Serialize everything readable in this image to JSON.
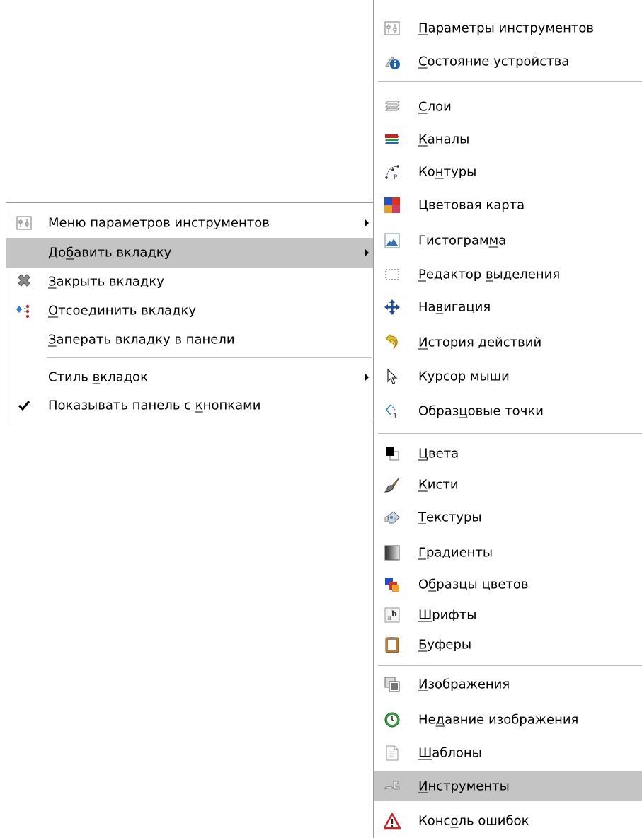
{
  "main_menu": {
    "items": [
      {
        "name": "menu-item-tool-options-menu",
        "pre": "Меню параметров инструментов",
        "u": "",
        "post": "",
        "icon": "tool-options-icon",
        "submenu": true,
        "checked": false,
        "highlighted": false
      },
      {
        "name": "menu-item-add-tab",
        "pre": "До",
        "u": "б",
        "post": "авить вкладку",
        "icon": "",
        "submenu": true,
        "checked": false,
        "highlighted": true
      },
      {
        "name": "menu-item-close-tab",
        "pre": "",
        "u": "З",
        "post": "акрыть вкладку",
        "icon": "close-tab-icon",
        "submenu": false,
        "checked": false,
        "highlighted": false
      },
      {
        "name": "menu-item-detach-tab",
        "pre": "",
        "u": "О",
        "post": "тсоединить вкладку",
        "icon": "detach-tab-icon",
        "submenu": false,
        "checked": false,
        "highlighted": false
      },
      {
        "name": "menu-item-lock-tab",
        "pre": "",
        "u": "З",
        "post": "аперать вкладку в панели",
        "icon": "",
        "submenu": false,
        "checked": false,
        "highlighted": false
      },
      {
        "name": "menu-item-tab-style",
        "pre": "Стиль ",
        "u": "в",
        "post": "кладок",
        "icon": "",
        "submenu": true,
        "checked": false,
        "highlighted": false
      },
      {
        "name": "menu-item-show-button-bar",
        "pre": "Показывать панель с ",
        "u": "к",
        "post": "нопками",
        "icon": "checkmark-icon",
        "submenu": false,
        "checked": true,
        "highlighted": false
      }
    ]
  },
  "sub_menu": {
    "items": [
      {
        "name": "submenu-item-tool-options",
        "pre": "",
        "u": "П",
        "post": "араметры инструментов",
        "icon": "tool-options-icon",
        "highlighted": false
      },
      {
        "name": "submenu-item-device-status",
        "pre": "",
        "u": "С",
        "post": "остояние устройства",
        "icon": "device-status-icon",
        "highlighted": false
      },
      {
        "name": "submenu-item-layers",
        "pre": "",
        "u": "С",
        "post": "лои",
        "icon": "layers-icon",
        "highlighted": false
      },
      {
        "name": "submenu-item-channels",
        "pre": "",
        "u": "К",
        "post": "аналы",
        "icon": "channels-icon",
        "highlighted": false
      },
      {
        "name": "submenu-item-paths",
        "pre": "Ко",
        "u": "н",
        "post": "туры",
        "icon": "paths-icon",
        "highlighted": false
      },
      {
        "name": "submenu-item-colormap",
        "pre": "Цветовая карта",
        "u": "",
        "post": "",
        "icon": "colormap-icon",
        "highlighted": false
      },
      {
        "name": "submenu-item-histogram",
        "pre": "Гистограм",
        "u": "м",
        "post": "а",
        "icon": "histogram-icon",
        "highlighted": false
      },
      {
        "name": "submenu-item-selection-editor",
        "pre": "",
        "u": "Р",
        "post": "едактор ",
        "u2": "в",
        "post2": "ыделения",
        "icon": "selection-editor-icon",
        "highlighted": false
      },
      {
        "name": "submenu-item-navigation",
        "pre": "На",
        "u": "в",
        "post": "игация",
        "icon": "navigation-icon",
        "highlighted": false
      },
      {
        "name": "submenu-item-undo-history",
        "pre": "",
        "u": "И",
        "post": "стория действий",
        "icon": "undo-history-icon",
        "highlighted": false
      },
      {
        "name": "submenu-item-pointer",
        "pre": "Курсор мыши",
        "u": "",
        "post": "",
        "icon": "pointer-icon",
        "highlighted": false
      },
      {
        "name": "submenu-item-sample-points",
        "pre": "Образ",
        "u": "ц",
        "post": "овые точки",
        "icon": "sample-points-icon",
        "highlighted": false
      },
      {
        "name": "submenu-item-colors",
        "pre": "",
        "u": "Ц",
        "post": "вета",
        "icon": "colors-icon",
        "highlighted": false
      },
      {
        "name": "submenu-item-brushes",
        "pre": "",
        "u": "К",
        "post": "исти",
        "icon": "brushes-icon",
        "highlighted": false
      },
      {
        "name": "submenu-item-patterns",
        "pre": "",
        "u": "Т",
        "post": "екстуры",
        "icon": "patterns-icon",
        "highlighted": false
      },
      {
        "name": "submenu-item-gradients",
        "pre": "",
        "u": "Г",
        "post": "радиенты",
        "icon": "gradients-icon",
        "highlighted": false
      },
      {
        "name": "submenu-item-palettes",
        "pre": "О",
        "u": "б",
        "post": "разцы цветов",
        "icon": "palettes-icon",
        "highlighted": false
      },
      {
        "name": "submenu-item-fonts",
        "pre": "",
        "u": "Ш",
        "post": "рифты",
        "icon": "fonts-icon",
        "highlighted": false
      },
      {
        "name": "submenu-item-buffers",
        "pre": "",
        "u": "Б",
        "post": "уферы",
        "icon": "buffers-icon",
        "highlighted": false
      },
      {
        "name": "submenu-item-images",
        "pre": "",
        "u": "И",
        "post": "зображения",
        "icon": "images-icon",
        "highlighted": false
      },
      {
        "name": "submenu-item-document-history",
        "pre": "Не",
        "u": "д",
        "post": "авние изображения",
        "icon": "document-history-icon",
        "highlighted": false
      },
      {
        "name": "submenu-item-templates",
        "pre": "",
        "u": "Ш",
        "post": "аблоны",
        "icon": "templates-icon",
        "highlighted": false
      },
      {
        "name": "submenu-item-tools",
        "pre": "",
        "u": "И",
        "post": "нструменты",
        "icon": "tools-icon",
        "highlighted": true
      },
      {
        "name": "submenu-item-error-console",
        "pre": "Конс",
        "u": "о",
        "post": "ль ошибок",
        "icon": "error-console-icon",
        "highlighted": false
      }
    ]
  },
  "colors": {
    "highlight": "#c4c4c4",
    "separator": "#c0c0c0",
    "menu_border": "#9a9a9a"
  }
}
